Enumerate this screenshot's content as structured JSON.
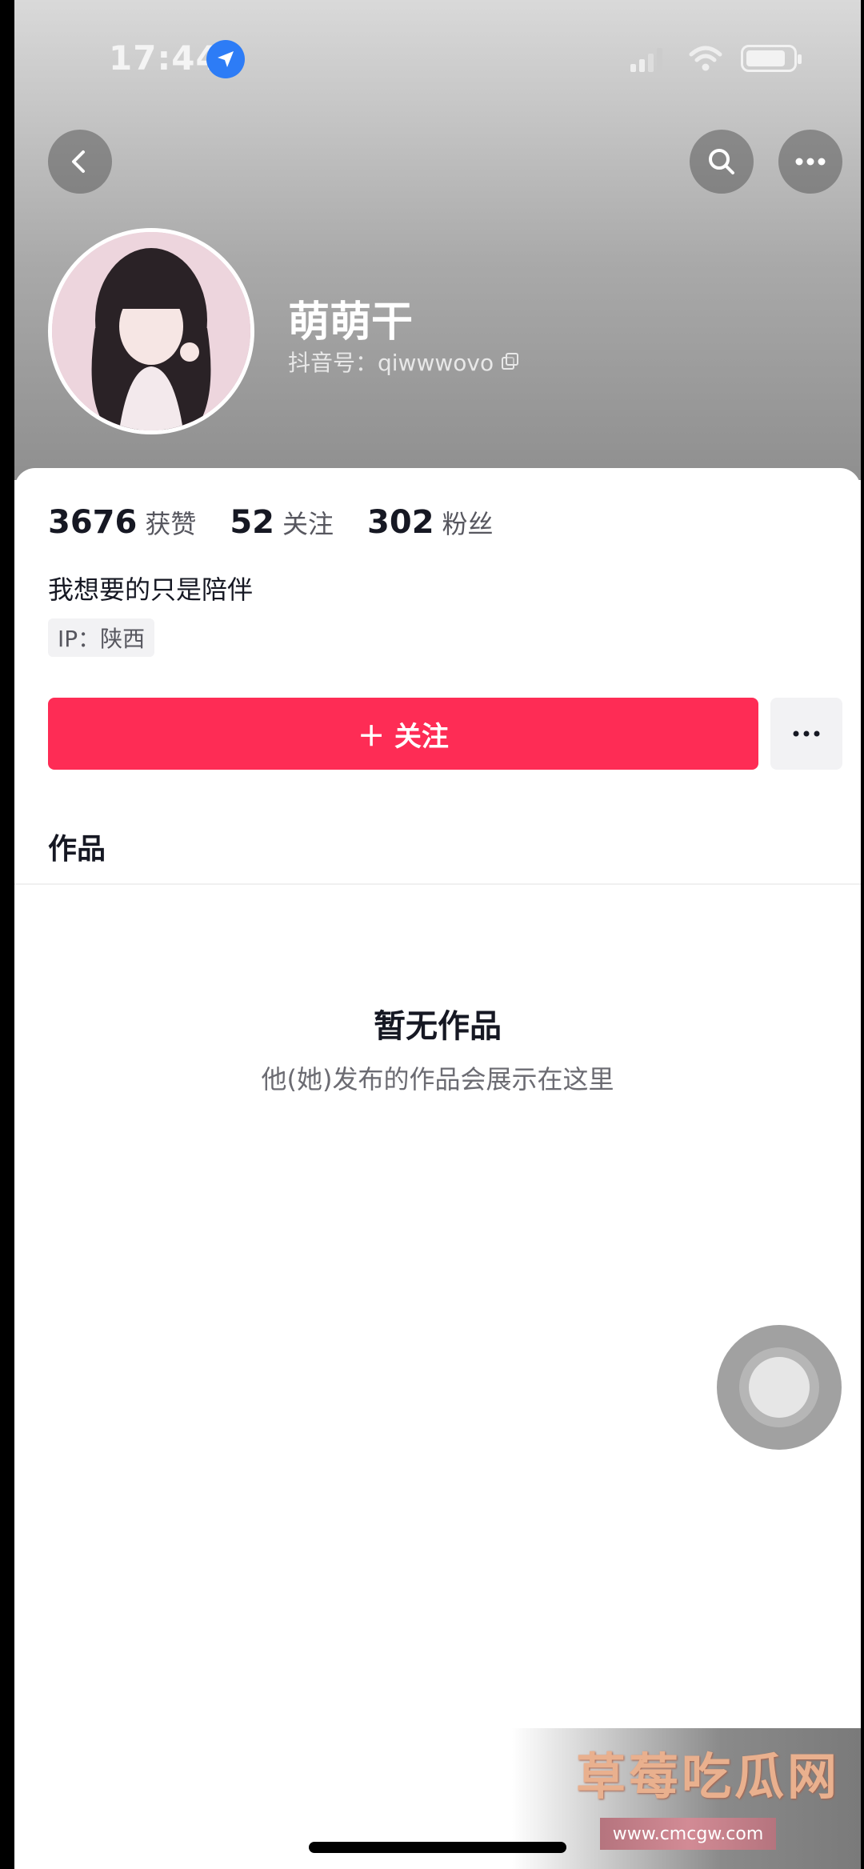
{
  "status_bar": {
    "time": "17:44"
  },
  "profile": {
    "nickname": "萌萌干",
    "douyin_id": "抖音号：qiwwwovo"
  },
  "stats": [
    {
      "value": "3676",
      "label": "获赞"
    },
    {
      "value": "52",
      "label": "关注"
    },
    {
      "value": "302",
      "label": "粉丝"
    }
  ],
  "bio": "我想要的只是陪伴",
  "ip": "IP：陕西",
  "actions": {
    "follow_label": "＋ 关注"
  },
  "tabs": {
    "works": "作品"
  },
  "empty_state": {
    "title": "暂无作品",
    "subtitle": "他(她)发布的作品会展示在这里"
  },
  "watermark": {
    "title": "草莓吃瓜网",
    "url": "www.cmcgw.com"
  },
  "colors": {
    "follow_button": "#fe2c55",
    "text_primary": "#161823",
    "location_badge": "#2d7cf6"
  }
}
